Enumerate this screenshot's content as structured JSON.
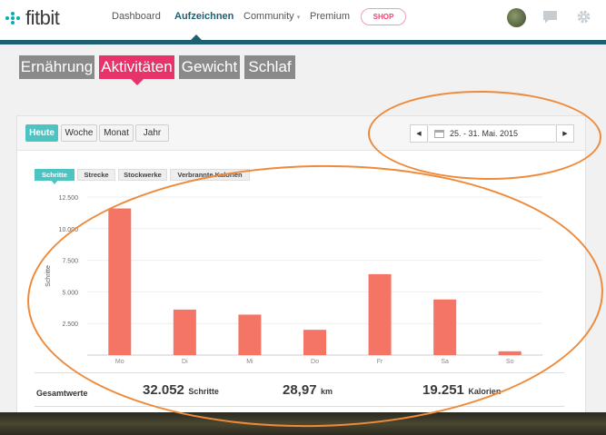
{
  "brand": {
    "name": "fitbit"
  },
  "nav": {
    "dashboard": "Dashboard",
    "aufzeichnen": "Aufzeichnen",
    "community": "Community",
    "community_caret": "▾",
    "premium": "Premium",
    "shop": "SHOP"
  },
  "categories": [
    "Ernährung",
    "Aktivitäten",
    "Gewicht",
    "Schlaf"
  ],
  "period_tabs": [
    "Heute",
    "Woche",
    "Monat",
    "Jahr"
  ],
  "date_range": "25. - 31. Mai. 2015",
  "metric_tabs": [
    "Schritte",
    "Strecke",
    "Stockwerke",
    "Verbrannte Kalorien"
  ],
  "chart_data": {
    "type": "bar",
    "title": "",
    "xlabel": "",
    "ylabel": "Schritte",
    "categories": [
      "Mo",
      "Di",
      "Mi",
      "Do",
      "Fr",
      "Sa",
      "So"
    ],
    "values": [
      11600,
      3600,
      3200,
      2000,
      6400,
      4400,
      300
    ],
    "ylim": [
      0,
      12500
    ],
    "yticks": [
      "12.500",
      "10.000",
      "7.500",
      "5.000",
      "2.500"
    ],
    "ytick_values": [
      12500,
      10000,
      7500,
      5000,
      2500
    ],
    "grid": true,
    "bar_color": "#f47565"
  },
  "totals": {
    "label": "Gesamtwerte",
    "steps_value": "32.052",
    "steps_unit": "Schritte",
    "distance_value": "28,97",
    "distance_unit": "km",
    "calories_value": "19.251",
    "calories_unit": "Kalorien"
  },
  "colors": {
    "accent": "#1f5f72",
    "teal": "#4ec4c2",
    "pink": "#e8336a",
    "annotation": "#ef8a3a"
  }
}
